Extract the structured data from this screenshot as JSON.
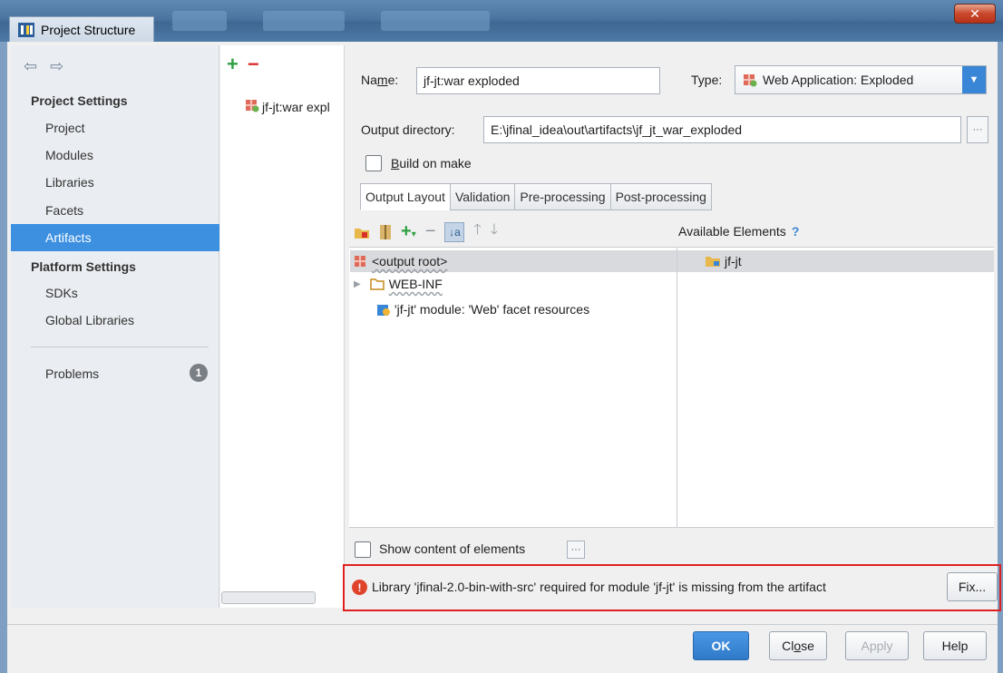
{
  "window": {
    "title": "Project Structure"
  },
  "sidebar": {
    "sections": [
      {
        "heading": "Project Settings",
        "items": [
          "Project",
          "Modules",
          "Libraries",
          "Facets",
          "Artifacts"
        ]
      },
      {
        "heading": "Platform Settings",
        "items": [
          "SDKs",
          "Global Libraries"
        ]
      }
    ],
    "problems_label": "Problems",
    "problems_count": "1",
    "selected": "Artifacts"
  },
  "artifact_list": {
    "items": [
      "jf-jt:war expl"
    ]
  },
  "form": {
    "name_label_pre": "Na",
    "name_label_mnemonic": "m",
    "name_label_post": "e:",
    "name_value": "jf-jt:war exploded",
    "type_label": "Type:",
    "type_value": "Web Application: Exploded",
    "output_dir_label": "Output directory:",
    "output_dir_value": "E:\\jfinal_idea\\out\\artifacts\\jf_jt_war_exploded",
    "build_on_make_mnemonic": "B",
    "build_on_make_rest": "uild on make",
    "build_on_make_checked": false
  },
  "tabs": [
    "Output Layout",
    "Validation",
    "Pre-processing",
    "Post-processing"
  ],
  "active_tab": "Output Layout",
  "layout_tree": {
    "root": "<output root>",
    "children": [
      "WEB-INF",
      "'jf-jt' module: 'Web' facet resources"
    ]
  },
  "available": {
    "heading": "Available Elements",
    "help": "?",
    "items": [
      "jf-jt"
    ]
  },
  "show_content_label": "Show content of elements",
  "error": {
    "message": "Library 'jfinal-2.0-bin-with-src' required for module 'jf-jt' is missing from the artifact",
    "fix_label": "Fix..."
  },
  "buttons": {
    "ok": "OK",
    "close_pre": "Cl",
    "close_mnemonic": "o",
    "close_post": "se",
    "apply": "Apply",
    "help": "Help"
  },
  "colors": {
    "selection": "#3d8fe0",
    "error": "#e02020",
    "add": "#2ea043",
    "remove": "#d9302c"
  }
}
